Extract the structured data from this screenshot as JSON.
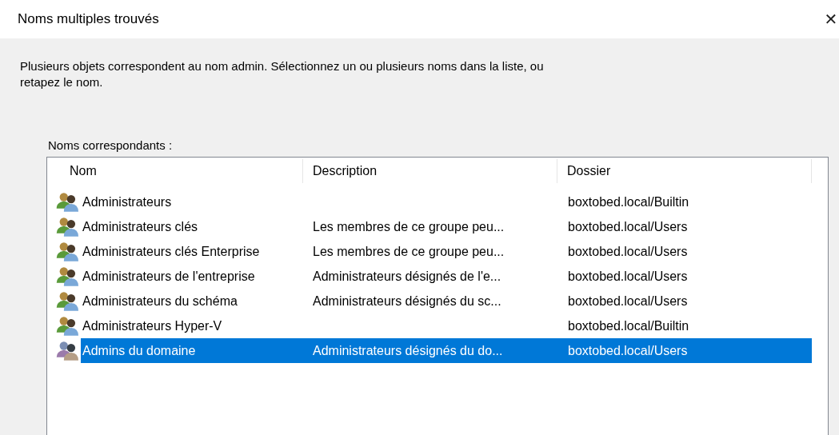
{
  "window": {
    "title": "Noms multiples trouvés",
    "close": "✕"
  },
  "message": "Plusieurs objets correspondent au nom admin. Sélectionnez un ou plusieurs noms dans la liste, ou retapez le nom.",
  "list_label": "Noms correspondants :",
  "table": {
    "columns": [
      "Nom",
      "Description",
      "Dossier"
    ],
    "rows": [
      {
        "name": "Administrateurs",
        "description": "",
        "folder": "boxtobed.local/Builtin",
        "selected": false
      },
      {
        "name": "Administrateurs clés",
        "description": "Les membres de ce groupe peu...",
        "folder": "boxtobed.local/Users",
        "selected": false
      },
      {
        "name": "Administrateurs clés Enterprise",
        "description": "Les membres de ce groupe peu...",
        "folder": "boxtobed.local/Users",
        "selected": false
      },
      {
        "name": "Administrateurs de l'entreprise",
        "description": "Administrateurs désignés de l'e...",
        "folder": "boxtobed.local/Users",
        "selected": false
      },
      {
        "name": "Administrateurs du schéma",
        "description": "Administrateurs désignés du sc...",
        "folder": "boxtobed.local/Users",
        "selected": false
      },
      {
        "name": "Administrateurs Hyper-V",
        "description": "",
        "folder": "boxtobed.local/Builtin",
        "selected": false
      },
      {
        "name": "Admins du domaine",
        "description": "Administrateurs désignés du do...",
        "folder": "boxtobed.local/Users",
        "selected": true
      }
    ]
  }
}
